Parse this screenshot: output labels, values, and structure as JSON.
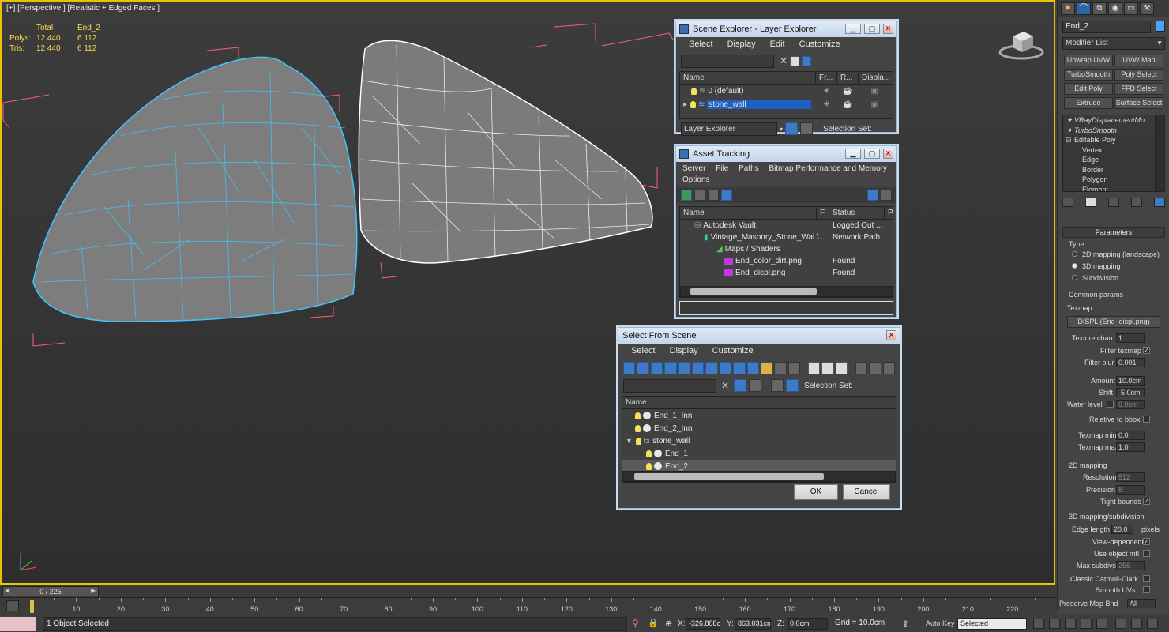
{
  "viewport": {
    "label": "[+] [Perspective ] [Realistic + Edged Faces ]",
    "stats": {
      "headers": [
        "",
        "Total",
        "End_2"
      ],
      "rows": [
        {
          "label": "Polys:",
          "total": "12 440",
          "obj": "6 112"
        },
        {
          "label": "Tris:",
          "total": "12 440",
          "obj": "6 112"
        }
      ]
    },
    "colors": {
      "selection_wire": "#3fc6ff",
      "wire": "#ffffff",
      "bbox": "#ff5a86",
      "mesh": "#808080"
    }
  },
  "scene_explorer": {
    "title": "Scene Explorer - Layer Explorer",
    "menu": [
      "Select",
      "Display",
      "Edit",
      "Customize"
    ],
    "columns": [
      "Name",
      "Fr...",
      "R...",
      "Displa..."
    ],
    "rows": [
      {
        "name": "0 (default)",
        "selected": false
      },
      {
        "name": "stone_wall",
        "selected": true
      }
    ],
    "footer_dropdown": "Layer Explorer",
    "selection_set_label": "Selection Set:"
  },
  "asset_tracking": {
    "title": "Asset Tracking",
    "menu": [
      "Server",
      "File",
      "Paths",
      "Bitmap Performance and Memory"
    ],
    "menu2": "Options",
    "columns": [
      "Name",
      "F.",
      "Status",
      "P"
    ],
    "rows": [
      {
        "name": "Autodesk Vault",
        "f": "",
        "status": "Logged Out ...",
        "indent": 0
      },
      {
        "name": "Vintage_Masonry_Stone_Wal...",
        "f": "\\..",
        "status": "Network Path",
        "indent": 1
      },
      {
        "name": "Maps / Shaders",
        "f": "",
        "status": "",
        "indent": 2
      },
      {
        "name": "End_color_dirt.png",
        "f": "",
        "status": "Found",
        "indent": 3
      },
      {
        "name": "End_displ.png",
        "f": "",
        "status": "Found",
        "indent": 3
      }
    ]
  },
  "select_from_scene": {
    "title": "Select From Scene",
    "menu": [
      "Select",
      "Display",
      "Customize"
    ],
    "selection_set_label": "Selection Set:",
    "column_name": "Name",
    "rows": [
      {
        "name": "End_1_Inn",
        "indent": 0,
        "selected": false
      },
      {
        "name": "End_2_Inn",
        "indent": 0,
        "selected": false
      },
      {
        "name": "stone_wall",
        "indent": 0,
        "selected": false
      },
      {
        "name": "End_1",
        "indent": 1,
        "selected": false
      },
      {
        "name": "End_2",
        "indent": 1,
        "selected": true
      }
    ],
    "ok_label": "OK",
    "cancel_label": "Cancel"
  },
  "command_panel": {
    "object_name": "End_2",
    "object_color": "#4aa3ff",
    "modifier_list": "Modifier List",
    "modifier_buttons": [
      "Unwrap UVW",
      "UVW Map",
      "TurboSmooth",
      "Poly Select",
      "Edit Poly",
      "FFD Select",
      "Extrude",
      "Surface Select"
    ],
    "stack": [
      "VRayDisplacementMo",
      "TurboSmooth",
      "Editable Poly",
      "Vertex",
      "Edge",
      "Border",
      "Polygon",
      "Element"
    ],
    "parameters": {
      "title": "Parameters",
      "type_label": "Type",
      "type_options": [
        "2D mapping (landscape)",
        "3D mapping",
        "Subdivision"
      ],
      "type_selected": 1,
      "common_params": "Common params",
      "texmap_label": "Texmap",
      "texmap_value": "DISPL (End_displ.png)",
      "texture_chan_label": "Texture chan",
      "texture_chan": "1",
      "filter_texmap_label": "Filter texmap",
      "filter_blur_label": "Filter blur",
      "filter_blur": "0.001",
      "amount_label": "Amount",
      "amount": "10.0cm",
      "shift_label": "Shift",
      "shift": "-5.0cm",
      "water_level_label": "Water level",
      "water_level": "0.0cm",
      "relative_bbox_label": "Relative to bbox",
      "texmap_min_label": "Texmap min",
      "texmap_min": "0.0",
      "texmap_max_label": "Texmap max",
      "texmap_max": "1.0",
      "mapping2d_title": "2D mapping",
      "resolution_label": "Resolution",
      "resolution": "512",
      "precision_label": "Precision",
      "precision": "8",
      "tight_bounds_label": "Tight bounds",
      "mapping3d_title": "3D mapping/subdivision",
      "edge_length_label": "Edge length",
      "edge_length": "20.0",
      "pixels_label": "pixels",
      "view_dependent_label": "View-dependent",
      "use_object_mtl_label": "Use object mtl",
      "max_subdivs_label": "Max subdivs",
      "max_subdivs": "256",
      "classic_catmull_label": "Classic Catmull-Clark",
      "smooth_uvs_label": "Smooth UVs",
      "preserve_map_label": "Preserve Map Bnd",
      "preserve_map_value": "All"
    }
  },
  "timeline": {
    "frame_label": "0 / 225",
    "ticks": [
      "10",
      "20",
      "30",
      "40",
      "50",
      "60",
      "70",
      "80",
      "90",
      "100",
      "110",
      "120",
      "130",
      "140",
      "150",
      "160",
      "170",
      "180",
      "190",
      "200",
      "210",
      "220"
    ]
  },
  "status_bar": {
    "selection_text": "1 Object Selected",
    "x_label": "X:",
    "x_value": "-326.808cr",
    "y_label": "Y:",
    "y_value": "863.031cm",
    "z_label": "Z:",
    "z_value": "0.0cm",
    "grid_label": "Grid = 10.0cm",
    "autokey_label": "Auto Key",
    "autokey_value": "Selected"
  }
}
